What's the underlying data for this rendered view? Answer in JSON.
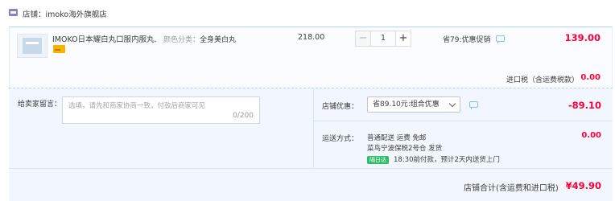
{
  "store": {
    "label": "店铺：",
    "name": "imoko海外旗舰店",
    "icon": "store-icon"
  },
  "item": {
    "title": "IMOKO日本耀白丸口服内服丸...",
    "spec_label": "颜色分类：",
    "spec_value": "全身美白丸",
    "unit_price": "218.00",
    "quantity": "1",
    "minus": "−",
    "plus": "+",
    "promo": "省79:优惠促销",
    "total": "139.00"
  },
  "tax": {
    "label": "进口税（含运费税款）",
    "value": "0.00"
  },
  "message": {
    "label": "给卖家留言：",
    "placeholder": "选填，请先和商家协商一致，付款后商家可见",
    "counter": "0/200"
  },
  "store_promo": {
    "label": "店铺优惠：",
    "selected": "省89.10元:组合优惠",
    "value": "-89.10"
  },
  "shipping": {
    "label": "运送方式：",
    "line1": "普通配送 运费 免邮",
    "line2": "菜鸟宁波保税2号仓  发货",
    "badge": "隔日达",
    "line3": "18:30前付款，预计2天内送货上门",
    "value": "0.00"
  },
  "grand_total": {
    "label": "店铺合计(含运费和进口税)",
    "value": "¥49.90"
  },
  "colors": {
    "price_red": "#ff0036",
    "panel_bg": "#f2f7ff",
    "accent_blue": "#b2d1ff",
    "badge_green": "#2ebc69"
  }
}
